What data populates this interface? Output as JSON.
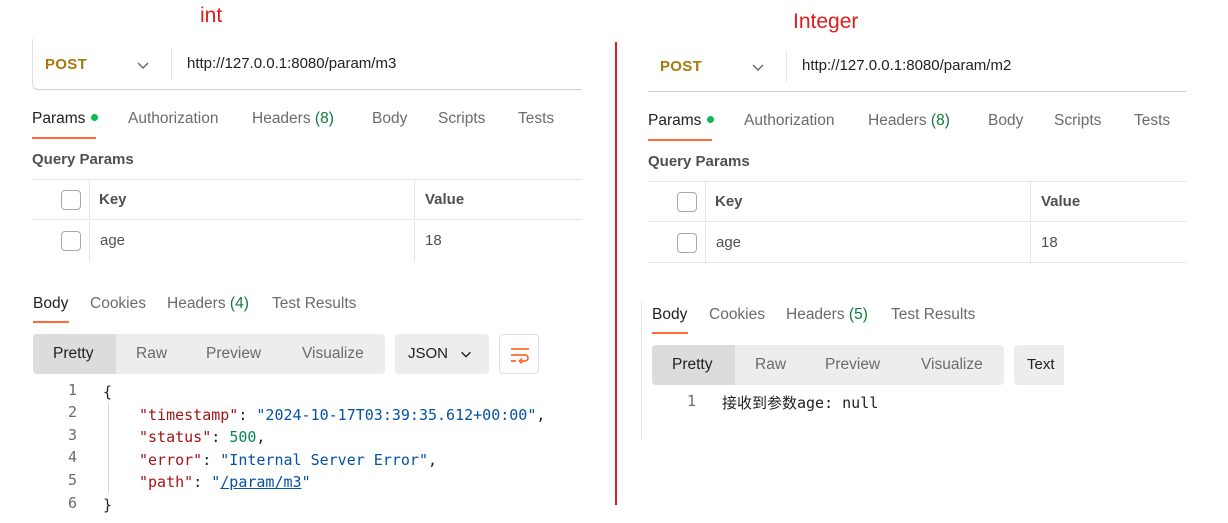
{
  "captions": {
    "left": "int",
    "right": "Integer"
  },
  "left": {
    "method": "POST",
    "url": "http://127.0.0.1:8080/param/m3",
    "request_tabs": [
      {
        "label": "Params",
        "active": true,
        "dot": true
      },
      {
        "label": "Authorization"
      },
      {
        "label": "Headers",
        "count": "(8)"
      },
      {
        "label": "Body"
      },
      {
        "label": "Scripts"
      },
      {
        "label": "Tests"
      }
    ],
    "query_title": "Query Params",
    "table": {
      "key_header": "Key",
      "value_header": "Value",
      "rows": [
        {
          "key": "age",
          "value": "18"
        }
      ]
    },
    "response_tabs": [
      {
        "label": "Body",
        "active": true
      },
      {
        "label": "Cookies"
      },
      {
        "label": "Headers",
        "count": "(4)"
      },
      {
        "label": "Test Results"
      }
    ],
    "view_modes": [
      "Pretty",
      "Raw",
      "Preview",
      "Visualize"
    ],
    "selected_mode": "Pretty",
    "format": "JSON",
    "line_numbers": [
      "1",
      "2",
      "3",
      "4",
      "5",
      "6"
    ],
    "json": {
      "open": "{",
      "close": "}",
      "timestamp_key": "\"timestamp\"",
      "timestamp_val": "\"2024-10-17T03:39:35.612+00:00\"",
      "status_key": "\"status\"",
      "status_val": "500",
      "error_key": "\"error\"",
      "error_val": "\"Internal Server Error\"",
      "path_key": "\"path\"",
      "path_quote": "\"",
      "path_val": "/param/m3"
    }
  },
  "right": {
    "method": "POST",
    "url": "http://127.0.0.1:8080/param/m2",
    "request_tabs": [
      {
        "label": "Params",
        "active": true,
        "dot": true
      },
      {
        "label": "Authorization"
      },
      {
        "label": "Headers",
        "count": "(8)"
      },
      {
        "label": "Body"
      },
      {
        "label": "Scripts"
      },
      {
        "label": "Tests"
      }
    ],
    "query_title": "Query Params",
    "table": {
      "key_header": "Key",
      "value_header": "Value",
      "rows": [
        {
          "key": "age",
          "value": "18"
        }
      ]
    },
    "response_tabs": [
      {
        "label": "Body",
        "active": true
      },
      {
        "label": "Cookies"
      },
      {
        "label": "Headers",
        "count": "(5)"
      },
      {
        "label": "Test Results"
      }
    ],
    "view_modes": [
      "Pretty",
      "Raw",
      "Preview",
      "Visualize"
    ],
    "selected_mode": "Pretty",
    "format": "Text",
    "line_numbers": [
      "1"
    ],
    "body_text": "接收到参数age: null"
  },
  "colors": {
    "accent": "#ff6c37",
    "method": "#a8790b",
    "caption": "#e01b1b",
    "dot": "#0cbb52"
  }
}
